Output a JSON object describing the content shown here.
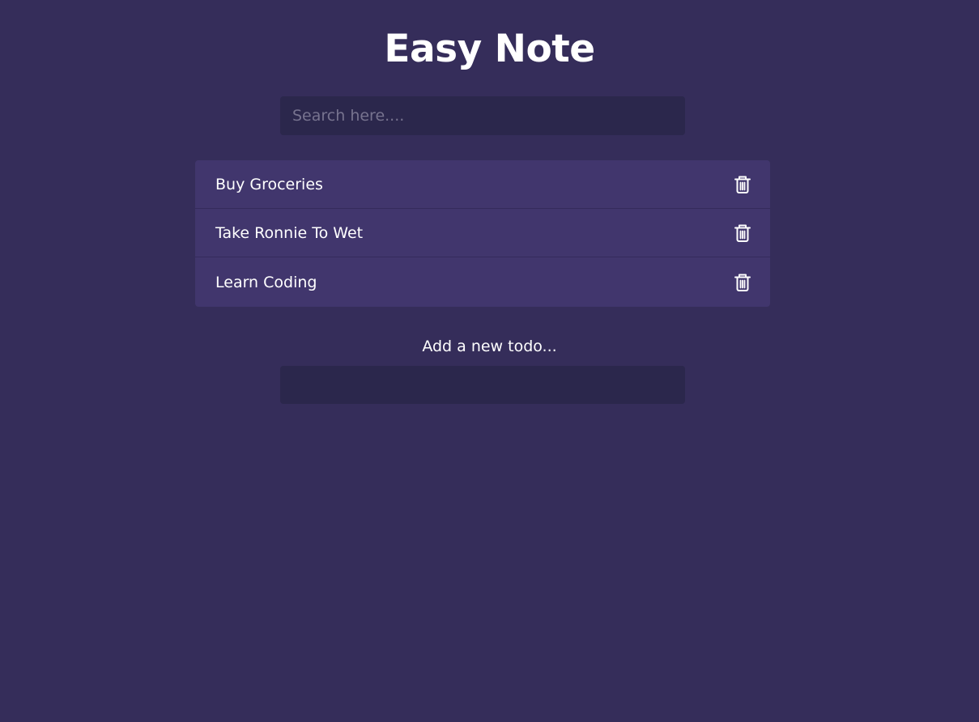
{
  "header": {
    "title": "Easy Note"
  },
  "search": {
    "placeholder": "Search here....",
    "value": ""
  },
  "todos": [
    {
      "label": "Buy Groceries",
      "action_icon": "trash-icon"
    },
    {
      "label": "Take Ronnie To Wet",
      "action_icon": "trash-icon"
    },
    {
      "label": "Learn Coding",
      "action_icon": "trash-icon"
    }
  ],
  "add_form": {
    "label": "Add a new todo...",
    "value": ""
  },
  "colors": {
    "background": "#352d5a",
    "input_background": "#2b274c",
    "list_background": "#41366d",
    "text": "#ffffff"
  }
}
